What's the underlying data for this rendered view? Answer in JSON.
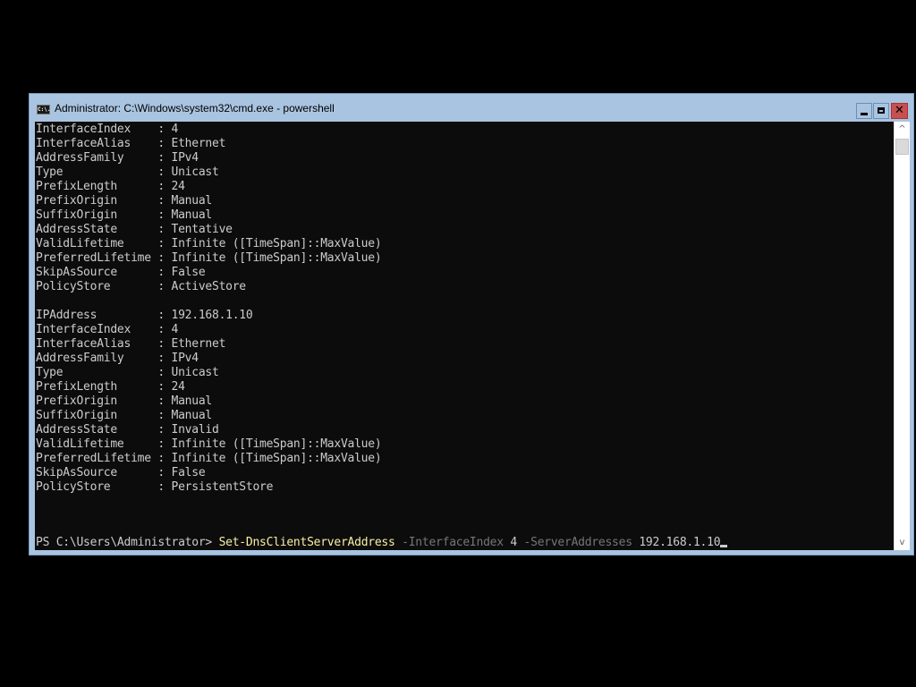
{
  "window": {
    "title": "Administrator: C:\\Windows\\system32\\cmd.exe - powershell",
    "app_icon_text": "C:\\.",
    "controls": {
      "minimize": "minimize-icon",
      "maximize": "maximize-icon",
      "close": "✕"
    }
  },
  "console": {
    "lines": [
      "InterfaceIndex    : 4",
      "InterfaceAlias    : Ethernet",
      "AddressFamily     : IPv4",
      "Type              : Unicast",
      "PrefixLength      : 24",
      "PrefixOrigin      : Manual",
      "SuffixOrigin      : Manual",
      "AddressState      : Tentative",
      "ValidLifetime     : Infinite ([TimeSpan]::MaxValue)",
      "PreferredLifetime : Infinite ([TimeSpan]::MaxValue)",
      "SkipAsSource      : False",
      "PolicyStore       : ActiveStore",
      "",
      "IPAddress         : 192.168.1.10",
      "InterfaceIndex    : 4",
      "InterfaceAlias    : Ethernet",
      "AddressFamily     : IPv4",
      "Type              : Unicast",
      "PrefixLength      : 24",
      "PrefixOrigin      : Manual",
      "SuffixOrigin      : Manual",
      "AddressState      : Invalid",
      "ValidLifetime     : Infinite ([TimeSpan]::MaxValue)",
      "PreferredLifetime : Infinite ([TimeSpan]::MaxValue)",
      "SkipAsSource      : False",
      "PolicyStore       : PersistentStore"
    ],
    "prompt": {
      "path": "PS C:\\Users\\Administrator> ",
      "command": "Set-DnsClientServerAddress",
      "param1": " -InterfaceIndex",
      "arg1": " 4",
      "param2": " -ServerAddresses",
      "arg2": " 192.168.1.10"
    }
  },
  "scrollbar": {
    "up": "^",
    "down": "v"
  },
  "colors": {
    "console_bg": "#0c0c0c",
    "console_fg": "#cccccc",
    "command": "#f9f1a5",
    "parameter": "#767676",
    "titlebar": "#a9c4e0",
    "close_button": "#c75050"
  }
}
